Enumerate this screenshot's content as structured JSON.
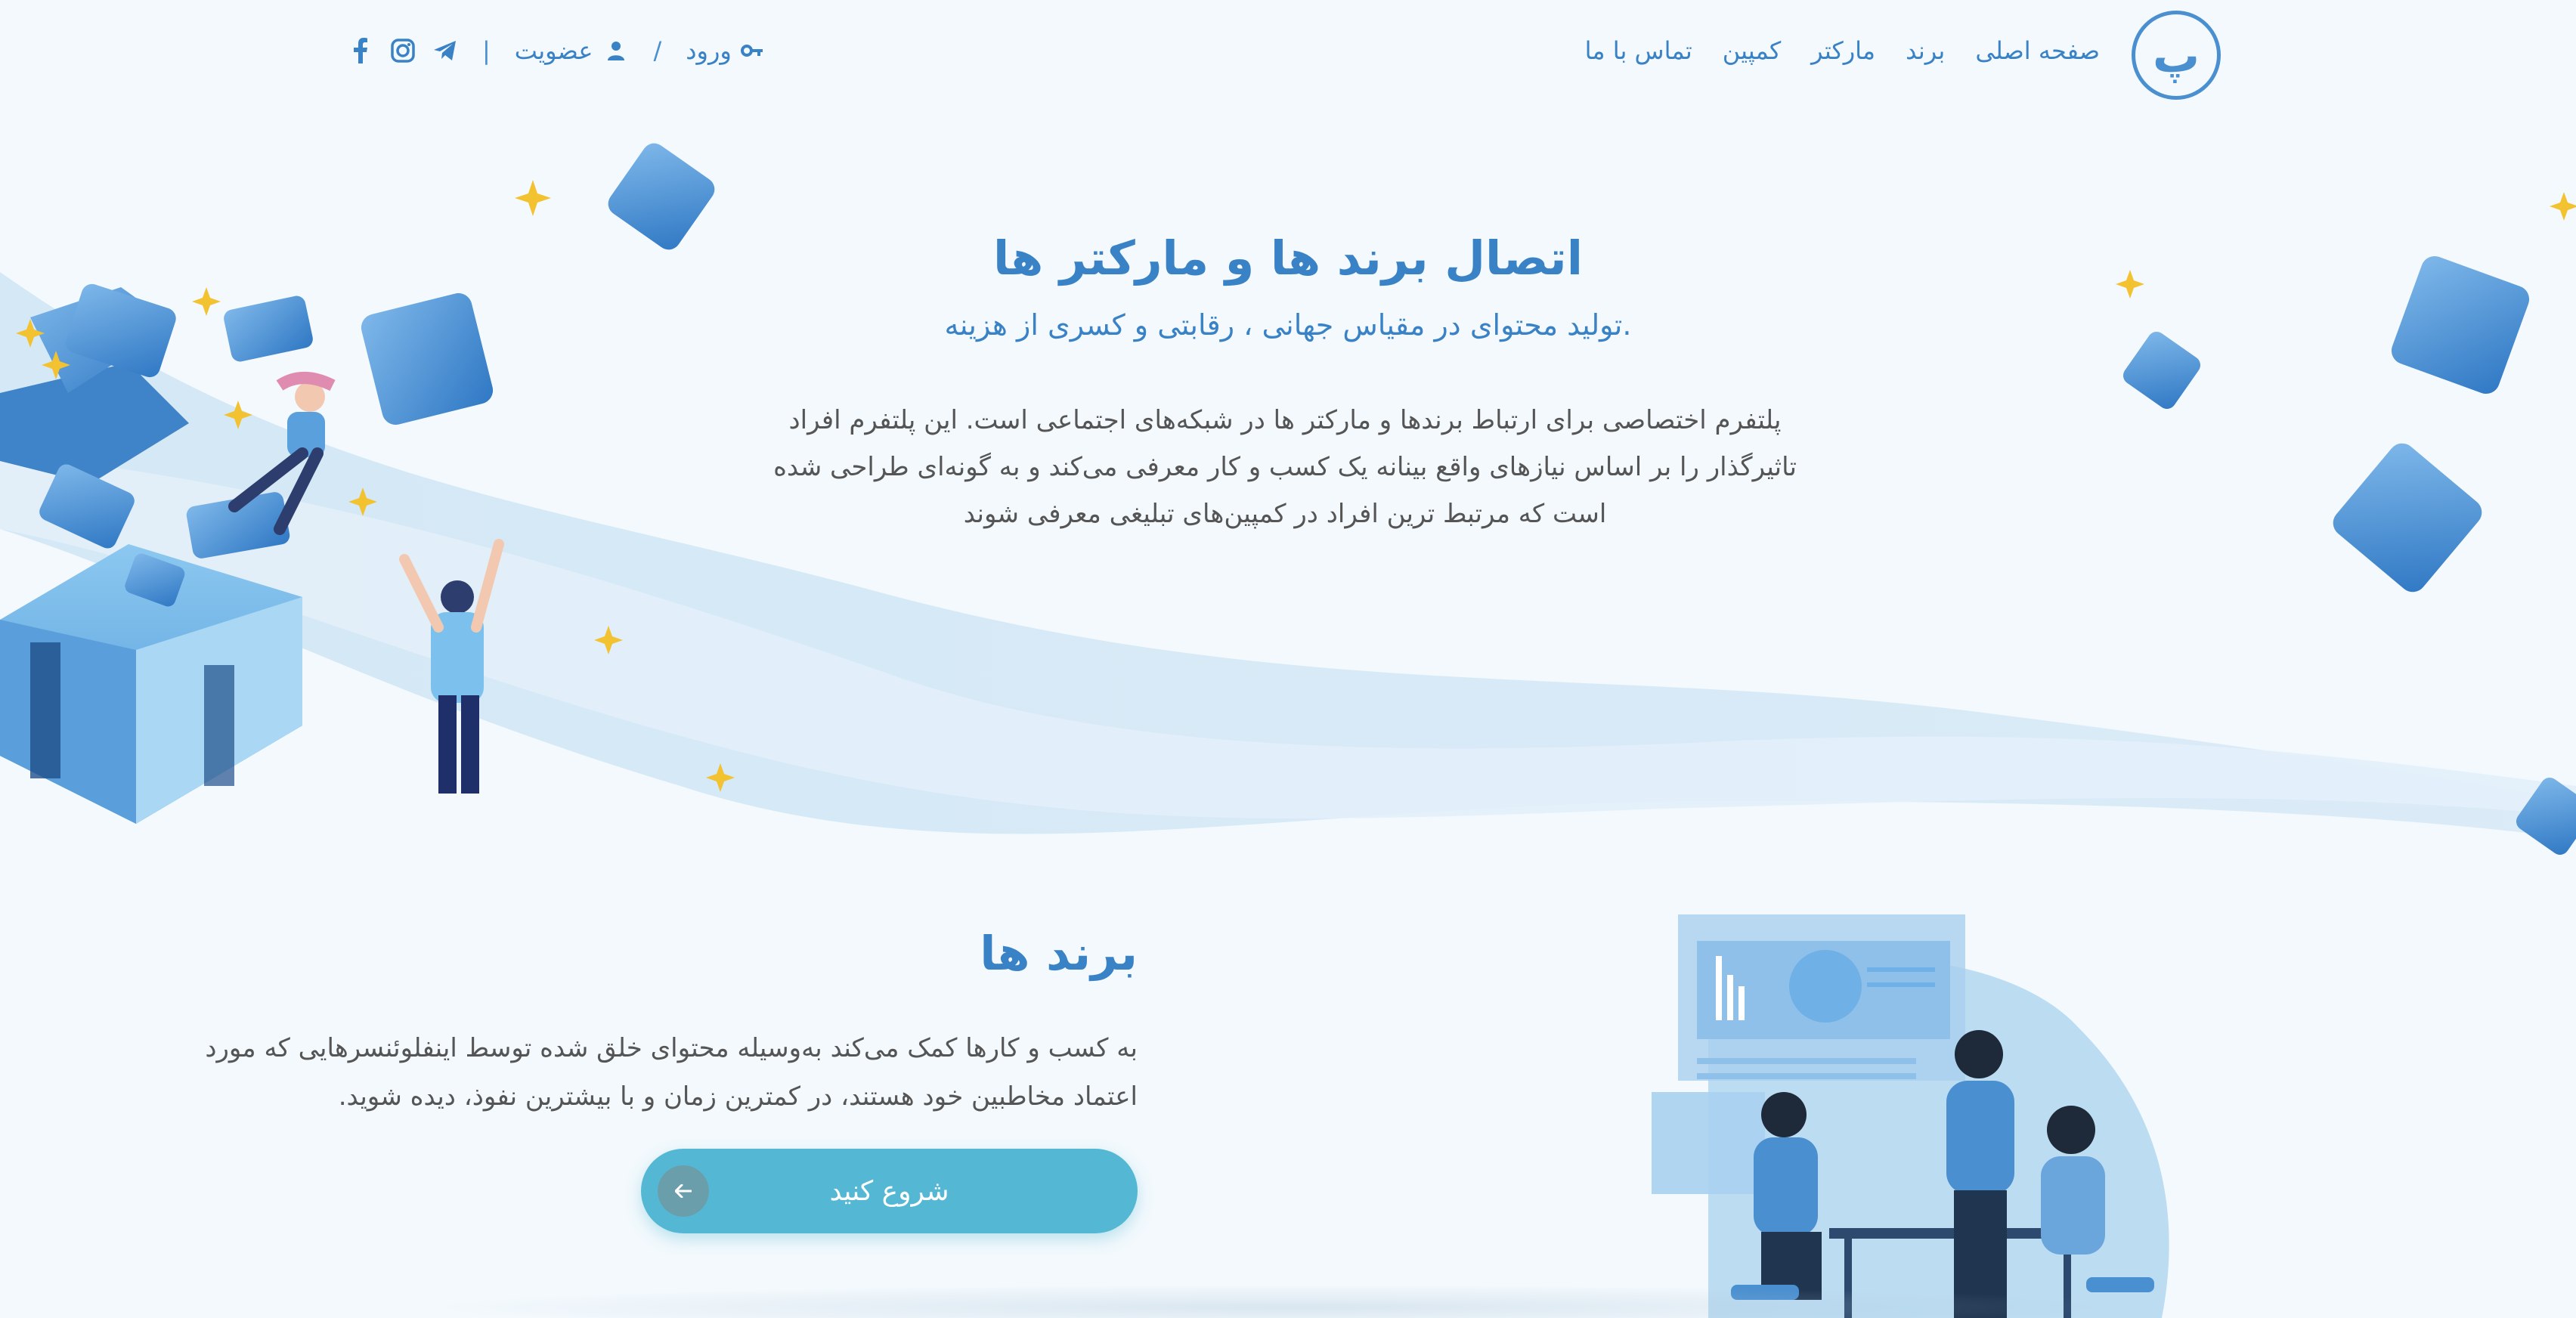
{
  "nav": {
    "logo_text": "پ",
    "menu": [
      "صفحه اصلی",
      "برند",
      "مارکتر",
      "کمپین",
      "تماس با ما"
    ],
    "login_label": "ورود",
    "signup_label": "عضویت",
    "separator": "/",
    "divider": "|",
    "social": [
      "instagram-icon",
      "telegram-icon",
      "facebook-icon"
    ]
  },
  "hero": {
    "title": "اتصال برند ها و مارکتر ها",
    "subtitle": "تولید محتوای در مقیاس جهانی ، رقابتی و کسری از هزینه.",
    "description": "پلتفرم اختصاصی برای ارتباط برندها و مارکتر ها در شبکه‌های اجتماعی است. این پلتفرم افراد تاثیرگذار را بر اساس نیازهای واقع بینانه یک کسب و کار معرفی می‌کند و به گونه‌ای طراحی شده است که مرتبط ترین افراد در کمپین‌های تبلیغی معرفی شوند"
  },
  "brands": {
    "title": "برند ها",
    "description": "به کسب و کارها کمک می‌کند به‌وسیله محتوای خلق شده توسط اینفلوئنسرهایی که مورد اعتماد مخاطبین خود هستند، در کمترین زمان و با بیشترین نفوذ، دیده شوید.",
    "cta_label": "شروع کنید",
    "cta_icon": "arrow-left-icon"
  },
  "colors": {
    "primary": "#3a82c6",
    "cta": "#54b8d4",
    "background": "#f3f9fd",
    "star": "#f2c230"
  }
}
